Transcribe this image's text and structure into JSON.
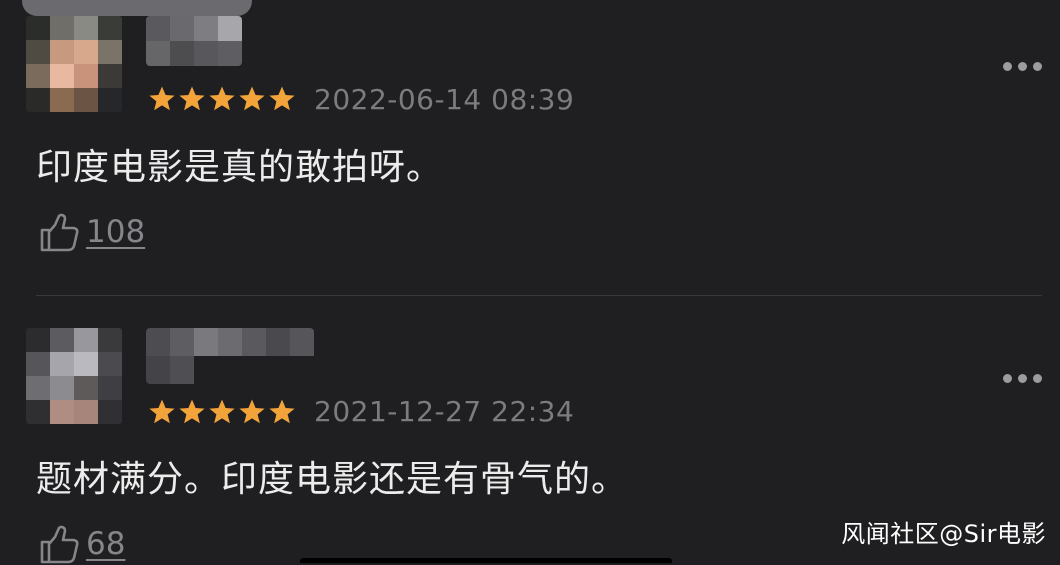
{
  "comments": [
    {
      "timestamp": "2022-06-14 08:39",
      "text": "印度电影是真的敢拍呀。",
      "likes": "108",
      "rating_stars": 5,
      "avatar_pixels": [
        "#2b2d2a",
        "#6f6e68",
        "#8a8a84",
        "#3a3c38",
        "#4f4a42",
        "#c79a7f",
        "#d8a88c",
        "#7a7468",
        "#7a6b5d",
        "#e8b9a0",
        "#c8937a",
        "#3c3a36",
        "#2a2a28",
        "#8b6a52",
        "#6b5444",
        "#25272a"
      ],
      "username_pixels": [
        "#5a5a5e",
        "#6a6a6e",
        "#7d7d82",
        "#a7a7ab",
        "#666669",
        "#4d4d50",
        "#58585c",
        "#5e5e62"
      ]
    },
    {
      "timestamp": "2021-12-27 22:34",
      "text": "题材满分。印度电影还是有骨气的。",
      "likes": "68",
      "rating_stars": 5,
      "avatar_pixels": [
        "#2c2c2e",
        "#5b5b60",
        "#97979d",
        "#3a3a3d",
        "#55555a",
        "#a5a5ab",
        "#b9b9bf",
        "#4a4a4f",
        "#6e6e72",
        "#8c8c90",
        "#5f5a5a",
        "#3f3f43",
        "#2f2f32",
        "#b08d82",
        "#a7857b",
        "#303034"
      ],
      "username_pixels": [
        "#4d4d51",
        "#5e5e62",
        "#7a7a7e",
        "#6c6c70",
        "#5a5a5e",
        "#4a4a4e",
        "#56565a",
        "#444448",
        "#4f4f53"
      ]
    }
  ],
  "colors": {
    "background": "#1f1f21",
    "star": "#f2a33a",
    "timestamp": "#7b7b80",
    "text": "#ececec",
    "like": "#85858a",
    "divider": "#38383b"
  },
  "icons": {
    "like": "thumbs-up-icon",
    "more": "more-dots-icon",
    "star": "star-icon"
  },
  "watermark": "风闻社区@Sir电影"
}
